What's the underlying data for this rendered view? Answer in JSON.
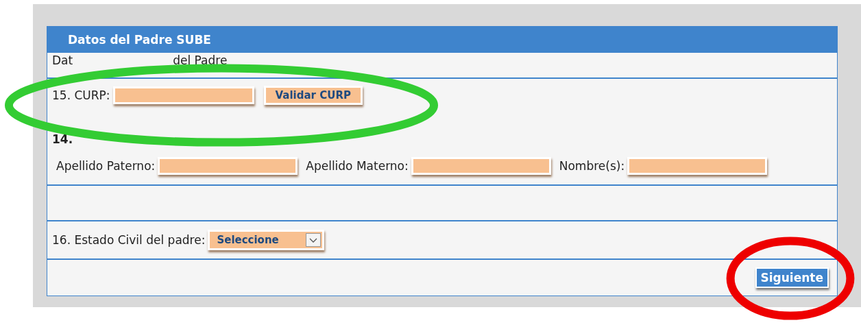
{
  "panel": {
    "title": "Datos del Padre SUBE",
    "section_parts": [
      "Dat",
      "del Padre"
    ],
    "curp": {
      "label": "15. CURP:",
      "button": "Validar CURP"
    },
    "name_heading": "14.",
    "name_fields": [
      {
        "label": "Apellido Paterno:"
      },
      {
        "label": "Apellido Materno:"
      },
      {
        "label": "Nombre(s):"
      }
    ],
    "estado_civil": {
      "label": "16. Estado Civil del padre:",
      "value": "Seleccione"
    },
    "next_button": "Siguiente"
  },
  "annotations": [
    {
      "kind": "ellipse",
      "color": "#33cc33"
    },
    {
      "kind": "ellipse",
      "color": "#ee0000"
    }
  ]
}
